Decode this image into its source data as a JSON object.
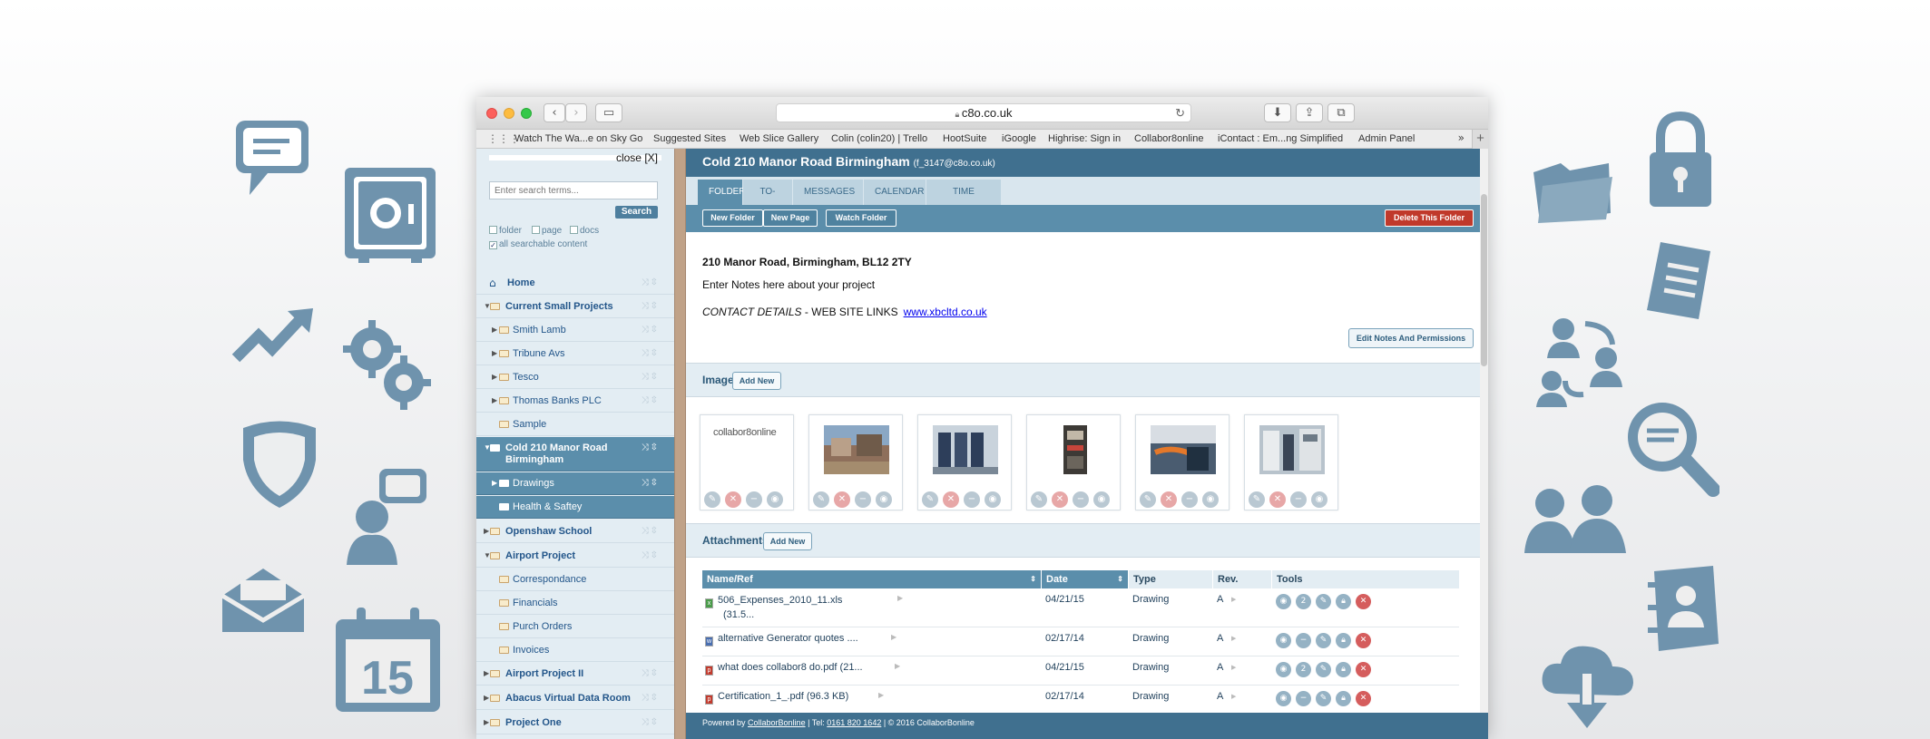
{
  "browser": {
    "url": "c8o.co.uk",
    "favorites": [
      "Watch The Wa...e on Sky Go",
      "Suggested Sites",
      "Web Slice Gallery",
      "Colin (colin20) | Trello",
      "HootSuite",
      "iGoogle",
      "Highrise: Sign in",
      "Collabor8online",
      "iContact : Em...ng Simplified",
      "Admin Panel"
    ]
  },
  "sidebar": {
    "close_label": "close [X]",
    "search_placeholder": "Enter search terms...",
    "search_button": "Search",
    "filters": [
      "folder",
      "page",
      "docs"
    ],
    "all_content_label": "all searchable content",
    "items": [
      {
        "label": "Home"
      },
      {
        "label": "Current Small Projects"
      },
      {
        "label": "Smith Lamb"
      },
      {
        "label": "Tribune Avs"
      },
      {
        "label": "Tesco"
      },
      {
        "label": "Thomas Banks PLC"
      },
      {
        "label": "Sample"
      },
      {
        "label": "Cold 210 Manor Road Birmingham"
      },
      {
        "label": "Drawings"
      },
      {
        "label": "Health & Saftey"
      },
      {
        "label": "Openshaw School"
      },
      {
        "label": "Airport Project"
      },
      {
        "label": "Correspondance"
      },
      {
        "label": "Financials"
      },
      {
        "label": "Purch Orders"
      },
      {
        "label": "Invoices"
      },
      {
        "label": "Airport Project II"
      },
      {
        "label": "Abacus Virtual Data Room"
      },
      {
        "label": "Project One"
      }
    ]
  },
  "main": {
    "title": "Cold 210 Manor Road Birmingham",
    "subtitle": "(f_3147@c8o.co.uk)",
    "tabs": [
      "FOLDER",
      "TO-DOS",
      "MESSAGES",
      "CALENDAR",
      "TIME SHEET"
    ],
    "buttons": {
      "new_folder": "New Folder",
      "new_page": "New Page",
      "watch_folder": "Watch Folder",
      "delete_folder": "Delete This Folder"
    },
    "address": "210 Manor Road, Birmingham, BL12 2TY",
    "notes": "Enter Notes here about your project",
    "contact_label": "CONTACT DETAILS",
    "contact_rest": " - WEB SITE LINKS",
    "weblink": "www.xbcltd.co.uk",
    "edit_notes": "Edit Notes And Permissions",
    "images_title": "Images",
    "attachments_title": "Attachments",
    "add_new": "Add New",
    "logo_text": "collabor8online",
    "table": {
      "headers": [
        "Name/Ref",
        "Date",
        "Type",
        "Rev.",
        "Tools"
      ],
      "rows": [
        {
          "name": "506_Expenses_2010_11.xls",
          "size": "(31.5...",
          "date": "04/21/15",
          "type": "Drawing",
          "rev": "A",
          "count": "2"
        },
        {
          "name": "alternative Generator quotes ....",
          "size": "",
          "date": "02/17/14",
          "type": "Drawing",
          "rev": "A",
          "count": ""
        },
        {
          "name": "what does collabor8 do.pdf (21...",
          "size": "",
          "date": "04/21/15",
          "type": "Drawing",
          "rev": "A",
          "count": "2"
        },
        {
          "name": "Certification_1_.pdf (96.3 KB)",
          "size": "",
          "date": "02/17/14",
          "type": "Drawing",
          "rev": "A",
          "count": ""
        }
      ]
    },
    "footer": {
      "powered": "Powered by ",
      "brand": "CollaborBonline",
      "tel": " | Tel: ",
      "phone": "0161 820 1642",
      "copy": " | © 2016 CollaborBonline"
    }
  },
  "calendar_day": "15",
  "colors": {
    "accent": "#40708f",
    "tab_active": "#5b8eab",
    "delete": "#c0392b",
    "icon_blue": "#6f93ad"
  }
}
